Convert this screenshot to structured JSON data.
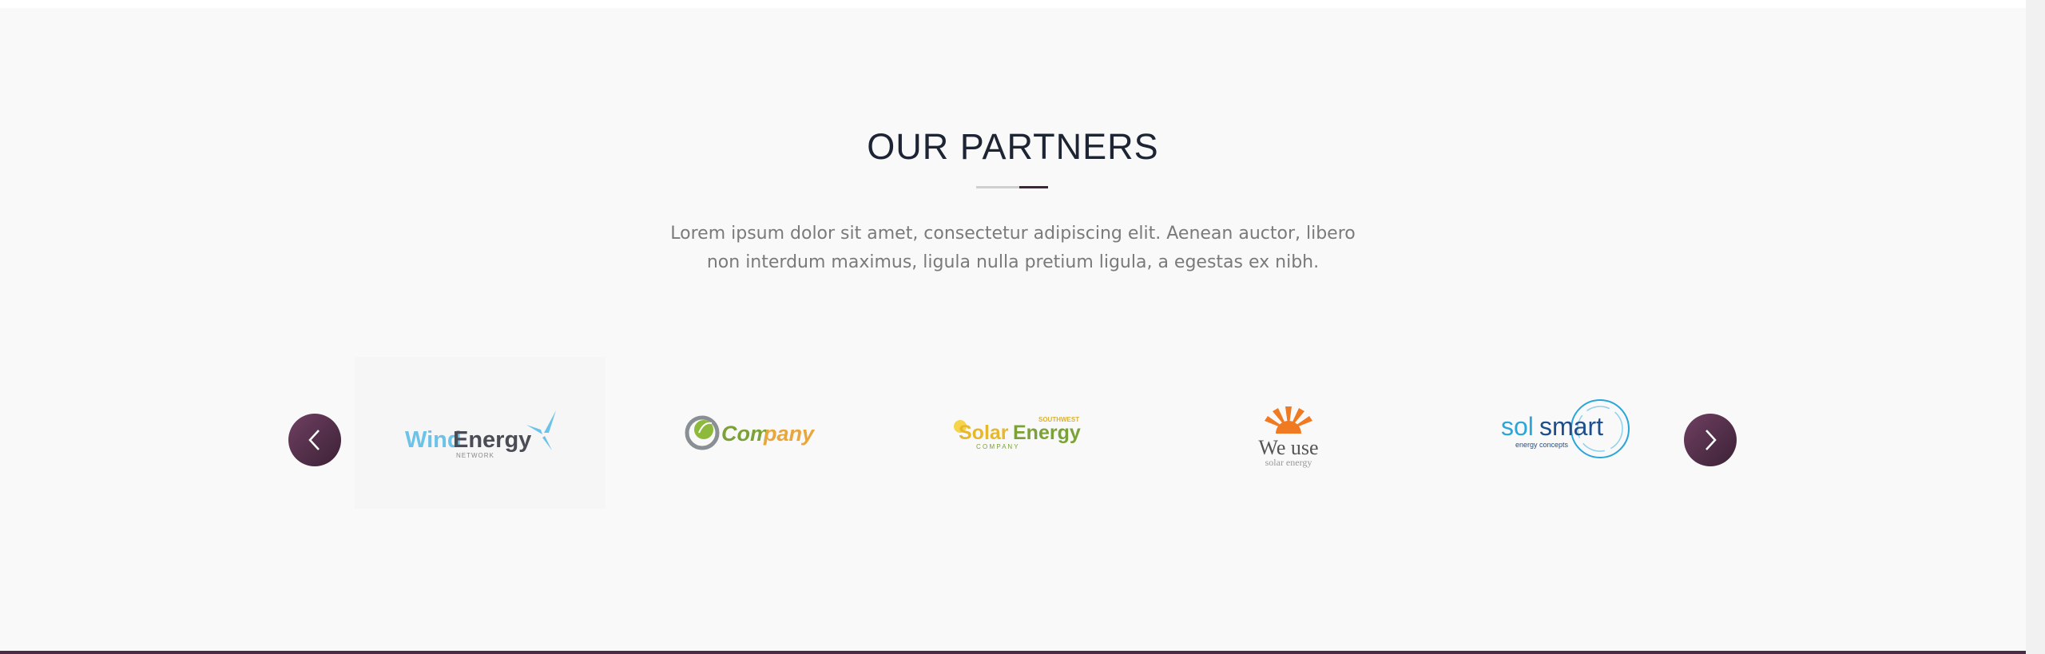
{
  "partners": {
    "title": "OUR PARTNERS",
    "description": "Lorem ipsum dolor sit amet, consectetur adipiscing elit. Aenean auctor, libero non interdum maximus, ligula nulla pretium ligula, a egestas ex nibh.",
    "prev_icon": "chevron-left-icon",
    "next_icon": "chevron-right-icon",
    "logos": [
      {
        "name": "WindEnergy",
        "part1": "Wind",
        "part2": "Energy",
        "sub": "NETWORK"
      },
      {
        "name": "Company",
        "part1": "Com",
        "part2": "pany"
      },
      {
        "name": "SolarEnergy",
        "part1": "Solar",
        "part2": "Energy",
        "top": "SOUTHWEST",
        "sub": "C O M P A N Y"
      },
      {
        "name": "We use solar energy",
        "part1": "We use",
        "sub": "solar energy"
      },
      {
        "name": "solsmart",
        "part1": "sol",
        "part2": "smart",
        "sub": "energy concepts"
      }
    ]
  },
  "colors": {
    "accent": "#5a3350",
    "title": "#1d2434",
    "text": "#7a7a7a"
  }
}
